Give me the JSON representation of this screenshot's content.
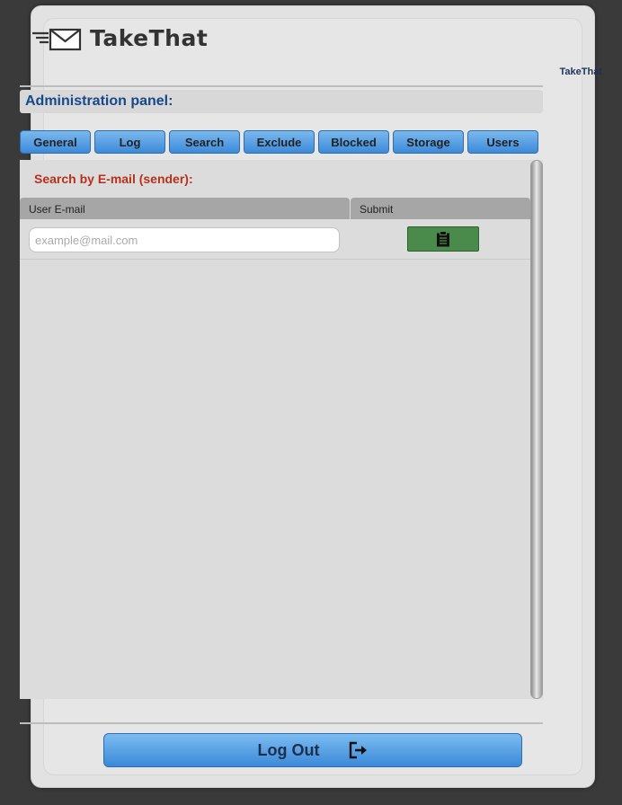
{
  "header": {
    "logo_text": "TakeThat",
    "brand_small": "TakeThat"
  },
  "admin": {
    "title": "Administration panel:"
  },
  "tabs": [
    {
      "label": "General"
    },
    {
      "label": "Log"
    },
    {
      "label": "Search"
    },
    {
      "label": "Exclude"
    },
    {
      "label": "Blocked"
    },
    {
      "label": "Storage"
    },
    {
      "label": "Users"
    }
  ],
  "search": {
    "title": "Search by E-mail (sender):",
    "col_email": "User E-mail",
    "col_submit": "Submit",
    "email_placeholder": "example@mail.com",
    "email_value": ""
  },
  "footer": {
    "logout_label": "Log Out"
  },
  "icons": {
    "logo": "mail-envelope-icon",
    "submit": "clipboard-icon",
    "logout": "sign-out-icon"
  }
}
